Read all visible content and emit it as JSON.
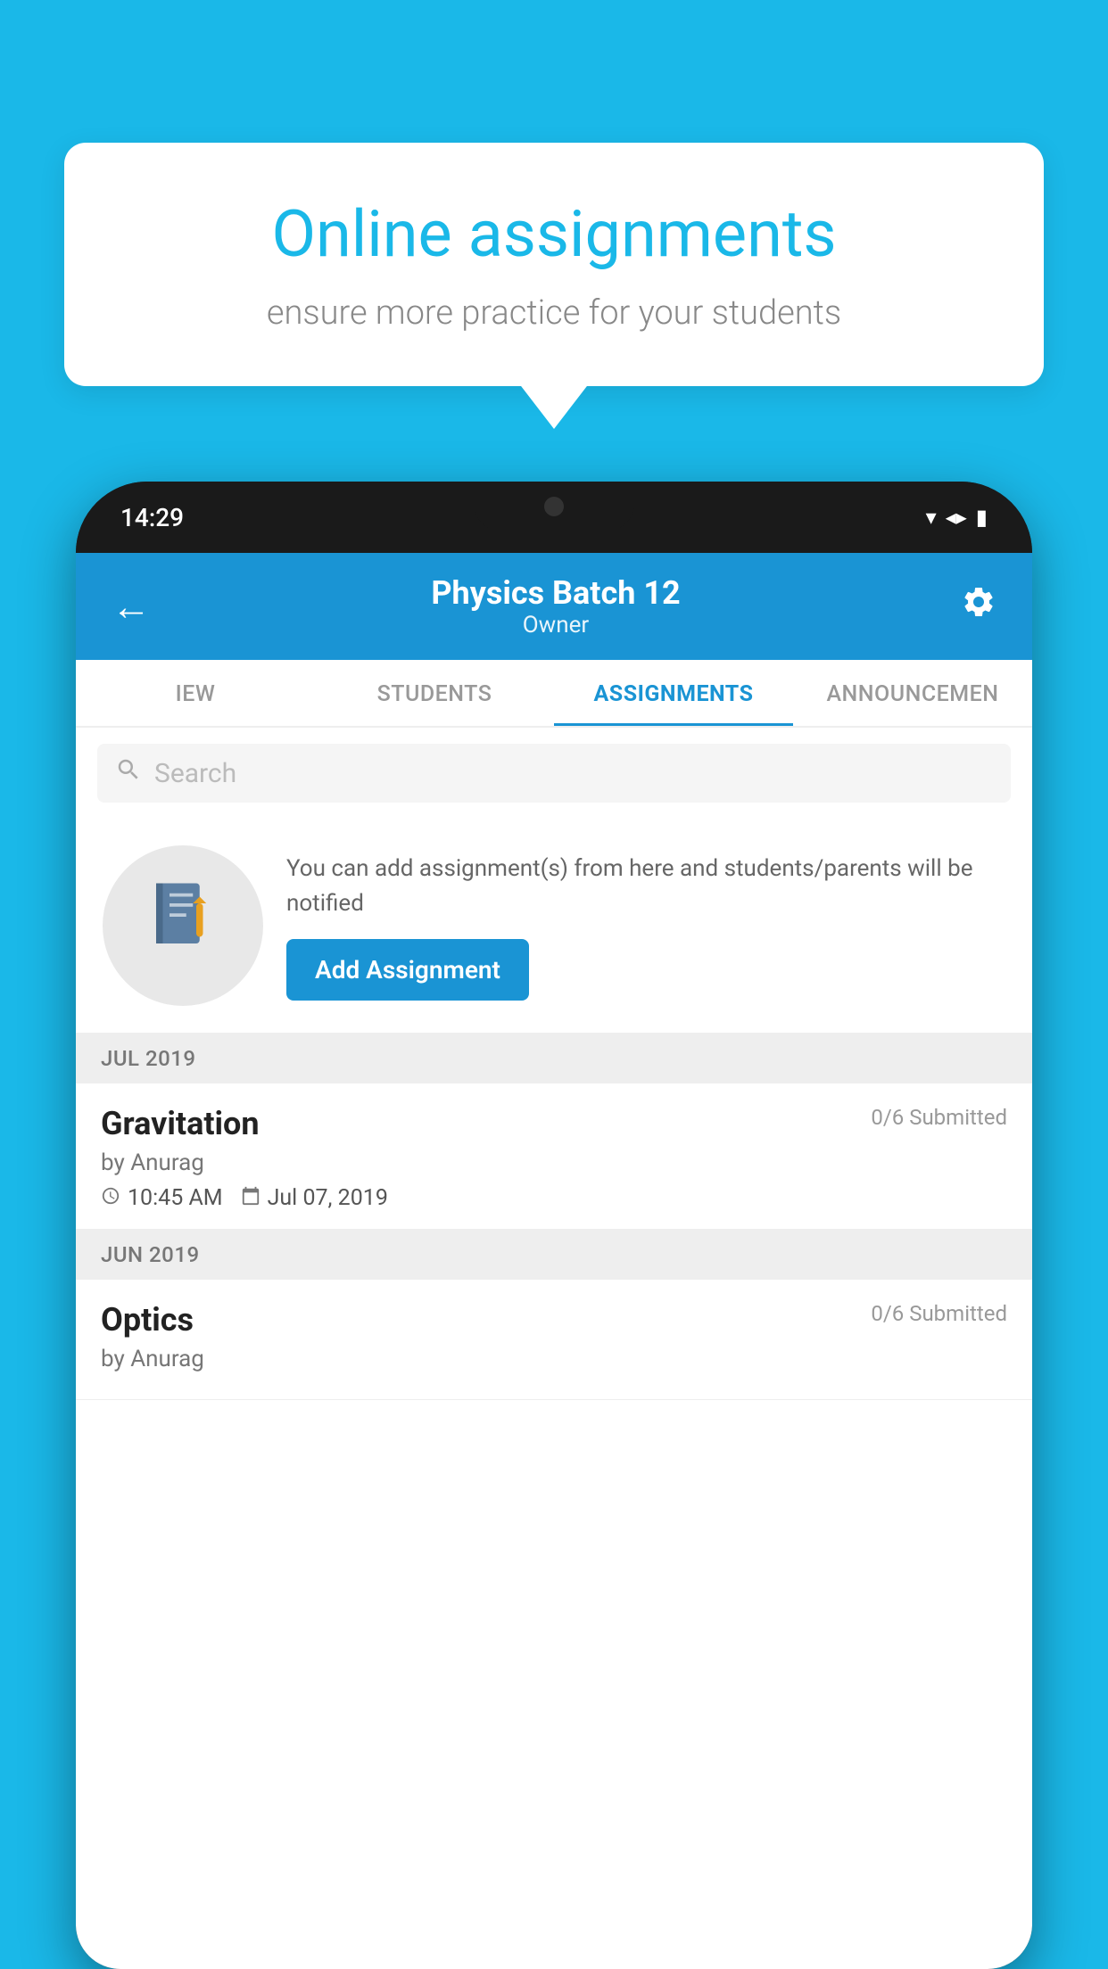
{
  "background_color": "#1ab8e8",
  "bubble": {
    "title": "Online assignments",
    "subtitle": "ensure more practice for your students"
  },
  "phone": {
    "time": "14:29",
    "header": {
      "title": "Physics Batch 12",
      "subtitle": "Owner",
      "back_label": "←",
      "settings_label": "⚙"
    },
    "tabs": [
      {
        "id": "view",
        "label": "IEW",
        "active": false
      },
      {
        "id": "students",
        "label": "STUDENTS",
        "active": false
      },
      {
        "id": "assignments",
        "label": "ASSIGNMENTS",
        "active": true
      },
      {
        "id": "announcements",
        "label": "ANNOUNCEMEN",
        "active": false
      }
    ],
    "search": {
      "placeholder": "Search"
    },
    "promo": {
      "text": "You can add assignment(s) from here and students/parents will be notified",
      "button_label": "Add Assignment"
    },
    "sections": [
      {
        "id": "jul2019",
        "header": "JUL 2019",
        "items": [
          {
            "name": "Gravitation",
            "submitted": "0/6 Submitted",
            "by": "by Anurag",
            "time": "10:45 AM",
            "date": "Jul 07, 2019"
          }
        ]
      },
      {
        "id": "jun2019",
        "header": "JUN 2019",
        "items": [
          {
            "name": "Optics",
            "submitted": "0/6 Submitted",
            "by": "by Anurag",
            "time": "",
            "date": ""
          }
        ]
      }
    ]
  }
}
